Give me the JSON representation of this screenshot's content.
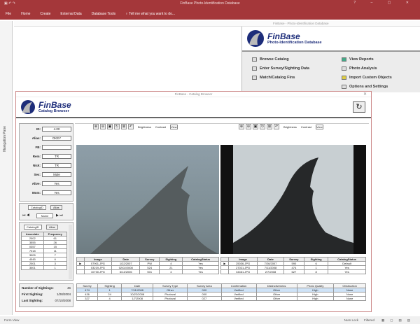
{
  "app": {
    "title": "FinBase Photo-Identification Database",
    "ribbon_tabs": [
      "File",
      "Home",
      "Create",
      "External Data",
      "Database Tools"
    ],
    "tell_me": "Tell me what you want to do..."
  },
  "nav": {
    "label": "Navigation Pane"
  },
  "switchboard": {
    "tab": "FinBase - Photo-Identification Database",
    "logo_title": "FinBase",
    "logo_subtitle": "Photo-Identification Database",
    "items": [
      "Browse Catalog",
      "Enter Survey/Sighting Data",
      "Match/Catalog Fins",
      "View Reports",
      "Photo Analysis",
      "Import Custom Objects",
      "Options and Settings"
    ]
  },
  "browser": {
    "title": "FinBase - Catalog Browser",
    "logo_title": "FinBase",
    "logo_subtitle": "Catalog Browser",
    "fields": [
      {
        "label": "ID:",
        "value": "4.00"
      },
      {
        "label": "Alias:",
        "value": "OKEY"
      },
      {
        "label": "FB:",
        "value": ""
      },
      {
        "label": "Rem:",
        "value": "TR"
      },
      {
        "label": "Nick:",
        "value": "TR"
      },
      {
        "label": "Sex:",
        "value": "Male"
      },
      {
        "label": "Alive:",
        "value": "Yes"
      },
      {
        "label": "Mom:",
        "value": "Yes"
      }
    ],
    "tabs1": [
      "CatalogID",
      "Alias"
    ],
    "record_nav": "Name",
    "tabs2": [
      "CatalogID",
      "Alias"
    ],
    "assoc_headers": [
      "Associate",
      "Frequency"
    ],
    "assoc_rows": [
      [
        "2002",
        "61"
      ],
      [
        "3555",
        "26"
      ],
      [
        "0357",
        "15"
      ],
      [
        "7018",
        "11"
      ],
      [
        "3005",
        "7"
      ],
      [
        "4045",
        "6"
      ],
      [
        "2001",
        "3"
      ],
      [
        "3001",
        "1"
      ]
    ],
    "summary": [
      {
        "label": "Number of Sightings:",
        "value": "46"
      },
      {
        "label": "First Sighting:",
        "value": "1/28/2004"
      },
      {
        "label": "Last Sighting:",
        "value": "07/10/2008"
      }
    ],
    "viewer_labels": {
      "brightness": "Brightness",
      "contrast": "Contrast",
      "view": "View"
    },
    "left_photo_headers": [
      "Image",
      "Date",
      "Survey",
      "Sighting",
      "CatalogStatus"
    ],
    "left_photo_rows": [
      [
        "07901.JPG",
        "1/22/2007",
        "PW",
        "4",
        "Yes"
      ],
      [
        "03219.JPG",
        "02/02/2008",
        "524",
        "21",
        "Yes"
      ],
      [
        "10730.JPG",
        "6/14/2006",
        "501",
        "4",
        "Yes"
      ]
    ],
    "right_photo_headers": [
      "Image",
      "Date",
      "Survey",
      "Sighting",
      "CatalogStatus"
    ],
    "right_photo_rows": [
      [
        "25036.JPG",
        "7/26/2007",
        "590",
        "6",
        "Default"
      ],
      [
        "27021.JPG",
        "7/11/2008",
        "474",
        "1",
        "Yes"
      ],
      [
        "34461.JPG",
        "2/7/2008",
        "627",
        "8",
        "Yes"
      ]
    ],
    "sight_headers": [
      "Survey",
      "Sighting",
      "Date",
      "Survey Type",
      "Survey Area",
      "Confirmation",
      "Distinctiveness",
      "Photo Quality",
      "Obstruction"
    ],
    "sight_rows": [
      [
        "474",
        "1",
        "7/11/2008",
        "Other",
        "000",
        "Verified",
        "Other",
        "High",
        "None"
      ],
      [
        "426",
        "24",
        "10/22/2008",
        "Photoval",
        "000",
        "Verified",
        "Other",
        "High",
        "None"
      ],
      [
        "327",
        "4",
        "1/7/2008",
        "Photoval",
        "027",
        "Verified",
        "Other",
        "High",
        "None"
      ]
    ]
  },
  "status": {
    "left": "Form View",
    "num_lock": "Num Lock",
    "filtered": "Filtered"
  },
  "colors": {
    "accent": "#a4373a",
    "logo": "#1d2d7a"
  }
}
